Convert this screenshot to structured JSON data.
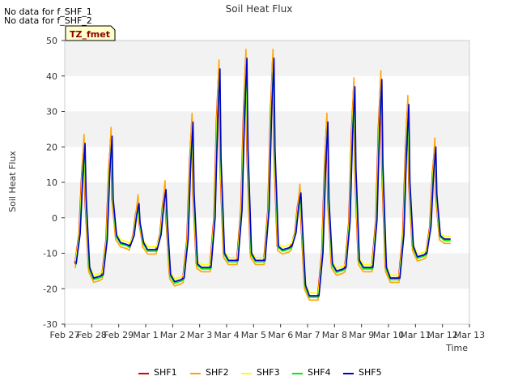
{
  "notes": [
    "No data for f_SHF_1",
    "No data for f_SHF_2"
  ],
  "chart_data": {
    "type": "line",
    "title": "Soil Heat Flux",
    "xlabel": "Time",
    "ylabel": "Soil Heat Flux",
    "ylim": [
      -30,
      50
    ],
    "yticks": [
      -30,
      -20,
      -10,
      0,
      10,
      20,
      30,
      40,
      50
    ],
    "xlim": [
      "2016-02-27",
      "2016-03-13"
    ],
    "xtick_labels": [
      "Feb 27",
      "Feb 28",
      "Feb 29",
      "Mar 1",
      "Mar 2",
      "Mar 3",
      "Mar 4",
      "Mar 5",
      "Mar 6",
      "Mar 7",
      "Mar 8",
      "Mar 9",
      "Mar 10",
      "Mar 11",
      "Mar 12",
      "Mar 13"
    ],
    "grid": "horizontal bands",
    "annotation": "TZ_fmet",
    "legend_position": "bottom",
    "series": [
      {
        "name": "SHF1",
        "color": "#dd0000"
      },
      {
        "name": "SHF2",
        "color": "#ffa500"
      },
      {
        "name": "SHF3",
        "color": "#ffff00"
      },
      {
        "name": "SHF4",
        "color": "#00ee00"
      },
      {
        "name": "SHF5",
        "color": "#0000cc"
      }
    ],
    "daily_key_points": {
      "columns": [
        "day_offset",
        "pre_dawn_min",
        "midday_peak",
        "post_dip",
        "evening_level"
      ],
      "rows": [
        [
          0.35,
          -13,
          21,
          -14,
          -17
        ],
        [
          1.35,
          -16,
          23,
          -5,
          -7
        ],
        [
          2.35,
          -8,
          4,
          -7,
          -9
        ],
        [
          3.35,
          -9,
          8,
          -16,
          -18
        ],
        [
          4.35,
          -17,
          27,
          -13,
          -14
        ],
        [
          5.35,
          -14,
          42,
          -10,
          -12
        ],
        [
          6.35,
          -12,
          45,
          -10,
          -12
        ],
        [
          7.35,
          -12,
          45,
          -8,
          -9
        ],
        [
          8.35,
          -8,
          7,
          -19,
          -22
        ],
        [
          9.35,
          -22,
          27,
          -13,
          -15
        ],
        [
          10.35,
          -14,
          37,
          -12,
          -14
        ],
        [
          11.35,
          -14,
          39,
          -14,
          -17
        ],
        [
          12.35,
          -17,
          32,
          -8,
          -11
        ],
        [
          13.35,
          -10,
          20,
          -5,
          -6
        ]
      ]
    },
    "series_peak_offsets": {
      "SHF1": 0.0,
      "SHF2": 2.5,
      "SHF3": -3.0,
      "SHF4": -2.0,
      "SHF5": 0.0
    }
  }
}
